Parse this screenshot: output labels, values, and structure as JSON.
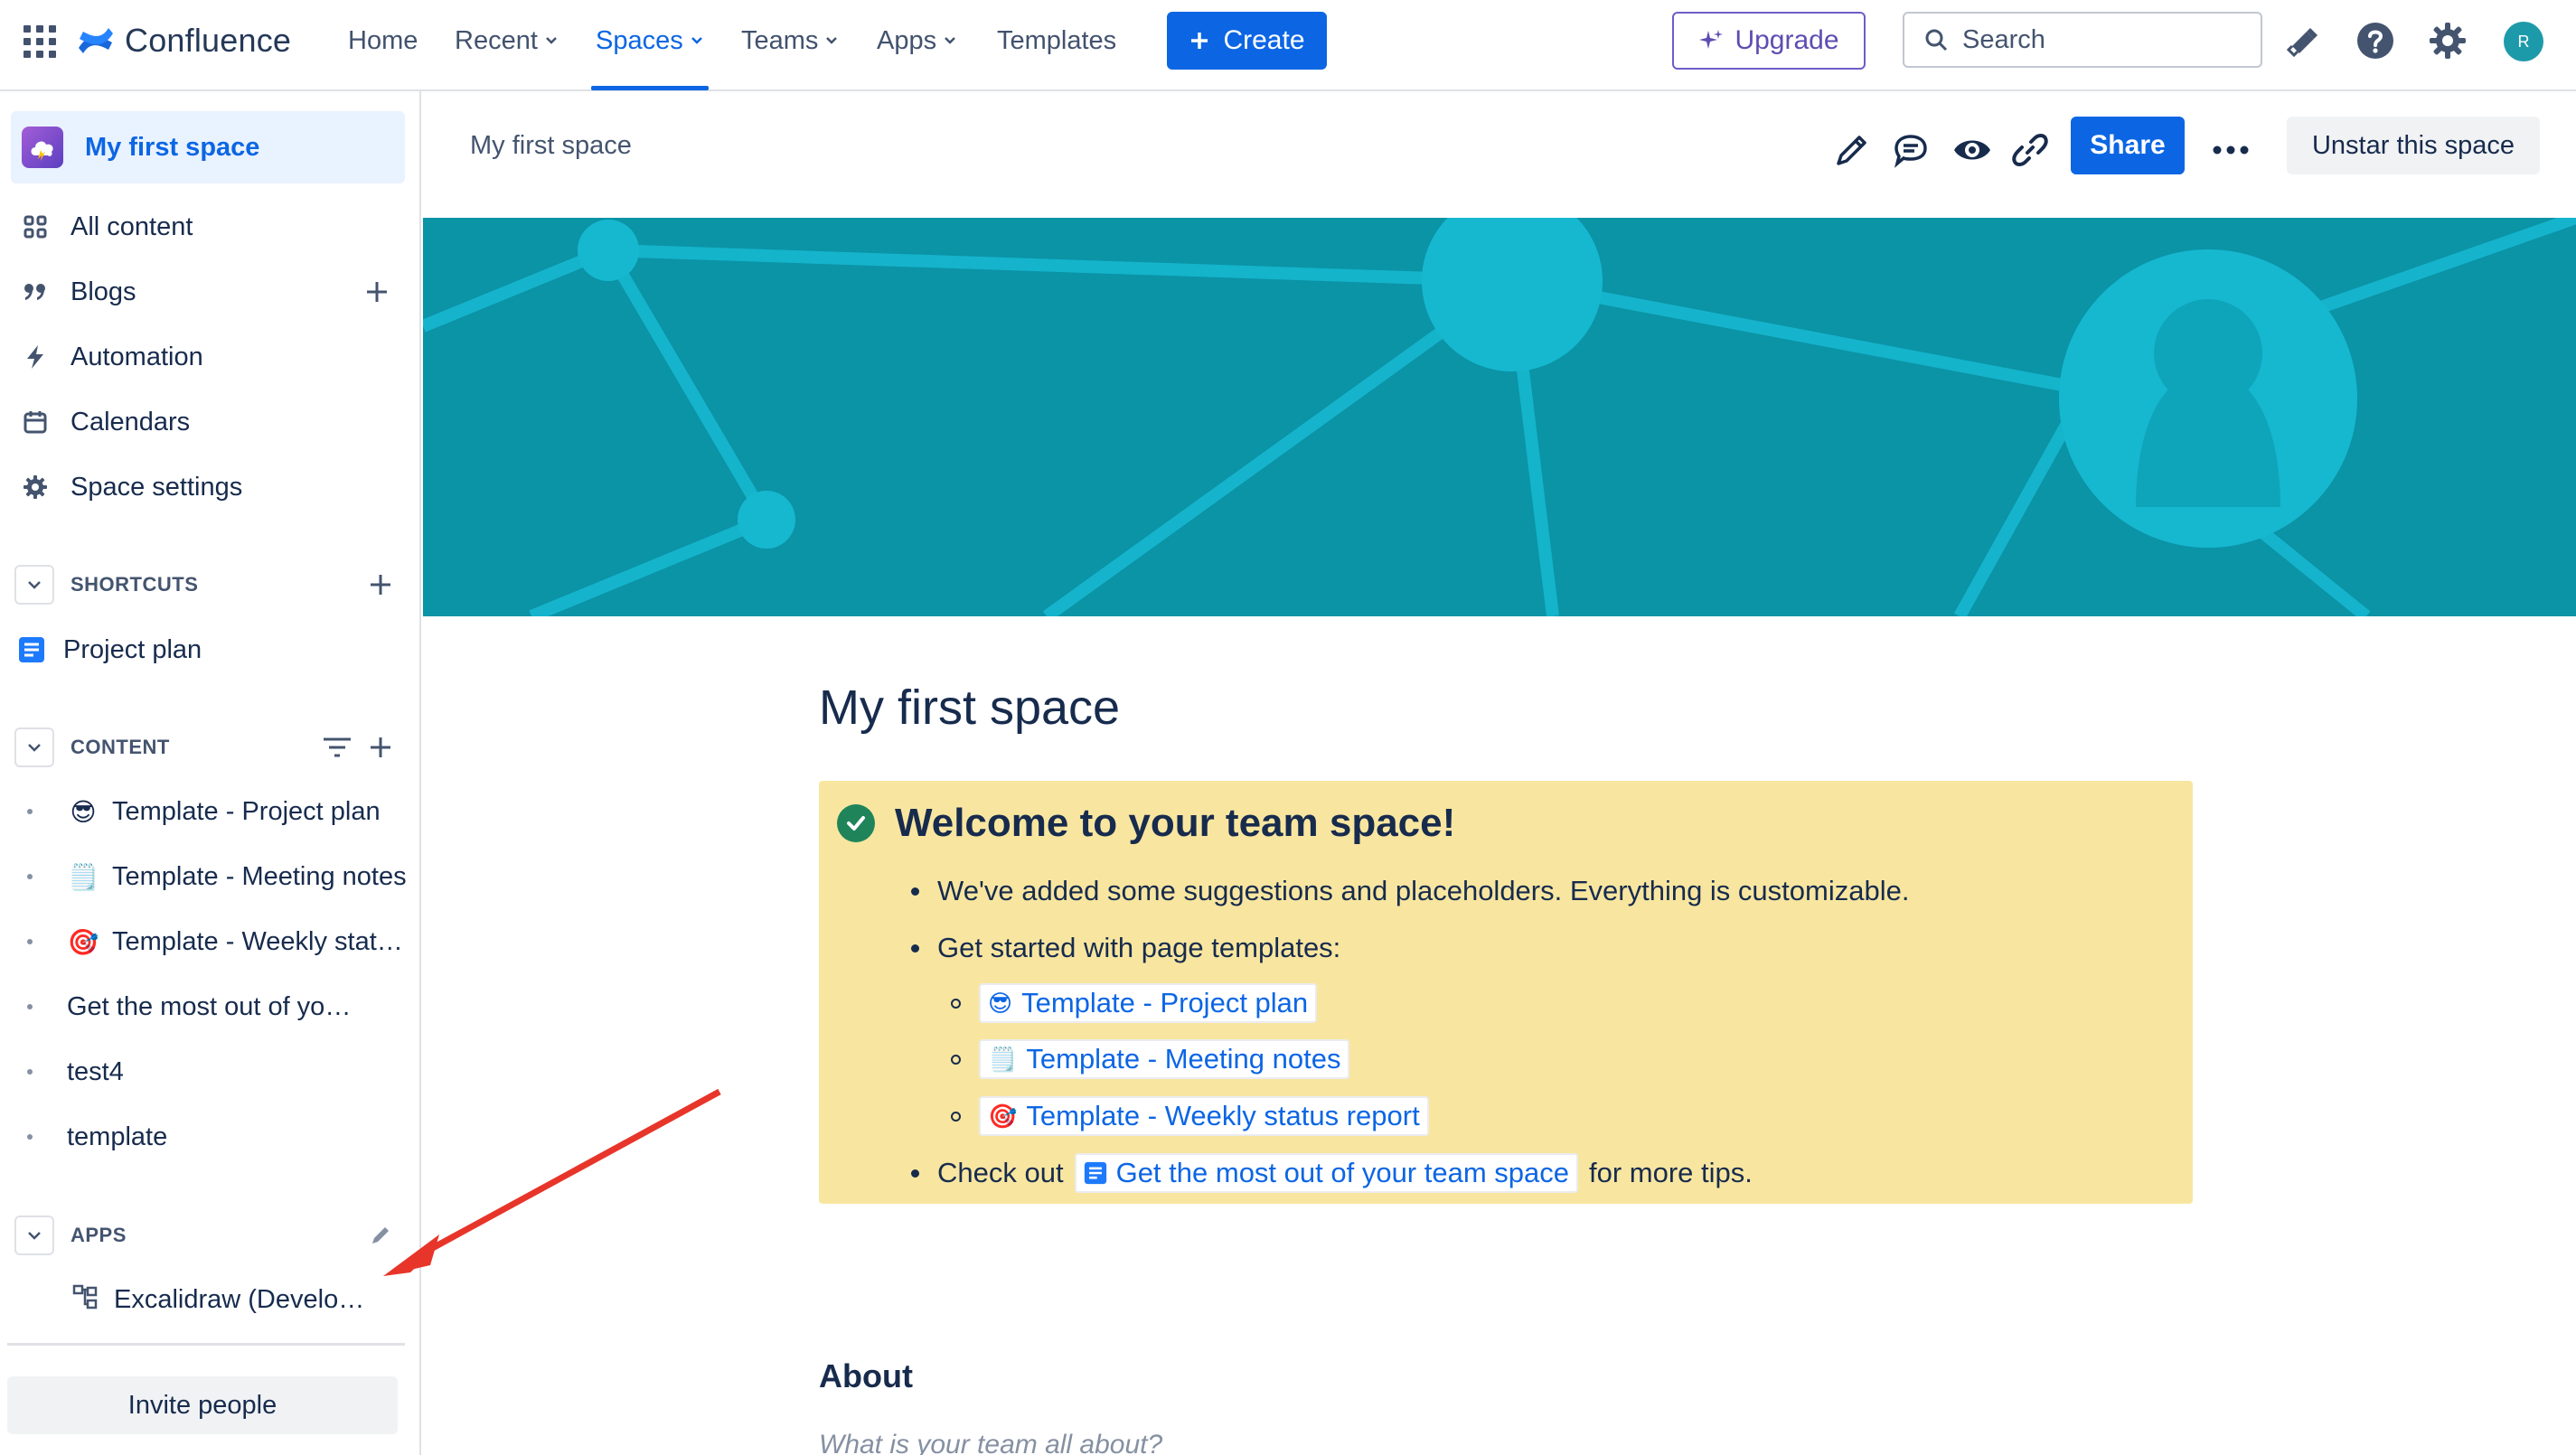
{
  "topnav": {
    "product_name": "Confluence",
    "items": [
      {
        "label": "Home"
      },
      {
        "label": "Recent"
      },
      {
        "label": "Spaces"
      },
      {
        "label": "Teams"
      },
      {
        "label": "Apps"
      },
      {
        "label": "Templates"
      }
    ],
    "create_label": "Create",
    "upgrade_label": "Upgrade",
    "search_placeholder": "Search",
    "avatar_initial": "R"
  },
  "sidebar": {
    "space_name": "My first space",
    "items": [
      {
        "label": "All content"
      },
      {
        "label": "Blogs"
      },
      {
        "label": "Automation"
      },
      {
        "label": "Calendars"
      },
      {
        "label": "Space settings"
      }
    ],
    "shortcuts_header": "SHORTCUTS",
    "shortcuts": [
      {
        "label": "Project plan"
      }
    ],
    "content_header": "CONTENT",
    "content_items": [
      {
        "emoji": "😎",
        "label": "Template - Project plan"
      },
      {
        "emoji": "🗒️",
        "label": "Template - Meeting notes"
      },
      {
        "emoji": "🎯",
        "label": "Template - Weekly status report"
      },
      {
        "emoji": "",
        "label": "Get the most out of your team space"
      },
      {
        "emoji": "",
        "label": "test4"
      },
      {
        "emoji": "",
        "label": "template"
      }
    ],
    "apps_header": "APPS",
    "apps": [
      {
        "label": "Excalidraw (Development)"
      }
    ],
    "invite_label": "Invite people"
  },
  "page_header": {
    "breadcrumb": "My first space",
    "share_label": "Share",
    "unstar_label": "Unstar this space"
  },
  "page": {
    "title": "My first space",
    "panel_title": "Welcome to your team space!",
    "bullet1": "We've added some suggestions and placeholders. Everything is customizable.",
    "bullet2": "Get started with page templates:",
    "templates": [
      {
        "emoji": "😎",
        "label": "Template - Project plan"
      },
      {
        "emoji": "🗒️",
        "label": "Template - Meeting notes"
      },
      {
        "emoji": "🎯",
        "label": "Template - Weekly status report"
      }
    ],
    "check_out_prefix": "Check out",
    "check_out_link": "Get the most out of your team space",
    "check_out_suffix": "for more tips.",
    "about_title": "About",
    "about_placeholder": "What is your team all about?"
  },
  "colors": {
    "brand_blue": "#0c66e4",
    "banner_teal": "#0b93a6",
    "panel_yellow": "#f8e6a0",
    "annotation_red": "#e8352a"
  }
}
